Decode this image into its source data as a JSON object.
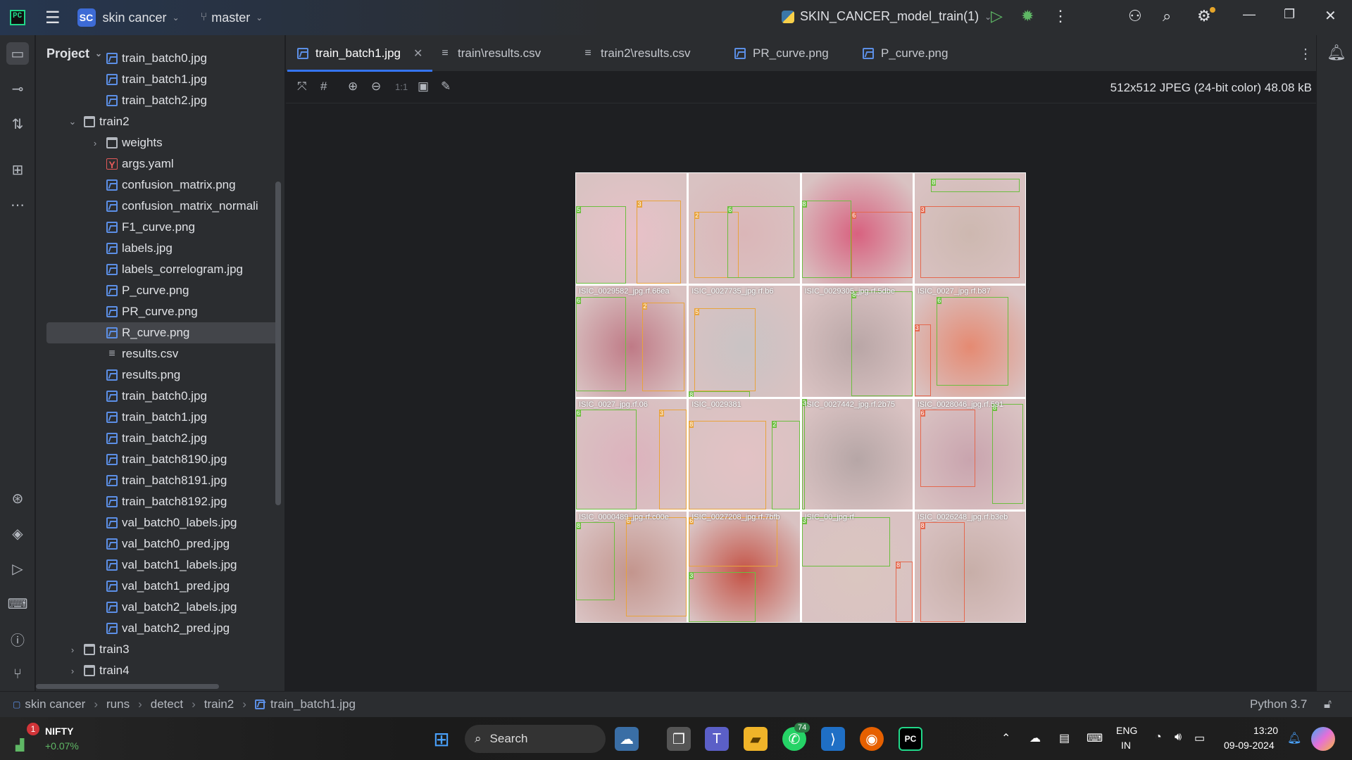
{
  "titlebar": {
    "project_badge": "SC",
    "project_name": "skin cancer",
    "branch": "master",
    "run_config": "SKIN_CANCER_model_train(1)"
  },
  "project_panel": {
    "title": "Project",
    "items": [
      {
        "label": "train_batch0.jpg",
        "kind": "image",
        "depth": 3
      },
      {
        "label": "train_batch1.jpg",
        "kind": "image",
        "depth": 3
      },
      {
        "label": "train_batch2.jpg",
        "kind": "image",
        "depth": 3
      },
      {
        "label": "train2",
        "kind": "folder-open",
        "depth": 2
      },
      {
        "label": "weights",
        "kind": "folder-closed",
        "depth": 3
      },
      {
        "label": "args.yaml",
        "kind": "yaml",
        "depth": 3
      },
      {
        "label": "confusion_matrix.png",
        "kind": "image",
        "depth": 3
      },
      {
        "label": "confusion_matrix_normali",
        "kind": "image",
        "depth": 3
      },
      {
        "label": "F1_curve.png",
        "kind": "image",
        "depth": 3
      },
      {
        "label": "labels.jpg",
        "kind": "image",
        "depth": 3
      },
      {
        "label": "labels_correlogram.jpg",
        "kind": "image",
        "depth": 3
      },
      {
        "label": "P_curve.png",
        "kind": "image",
        "depth": 3
      },
      {
        "label": "PR_curve.png",
        "kind": "image",
        "depth": 3
      },
      {
        "label": "R_curve.png",
        "kind": "image",
        "depth": 3,
        "selected": true
      },
      {
        "label": "results.csv",
        "kind": "text",
        "depth": 3
      },
      {
        "label": "results.png",
        "kind": "image",
        "depth": 3
      },
      {
        "label": "train_batch0.jpg",
        "kind": "image",
        "depth": 3
      },
      {
        "label": "train_batch1.jpg",
        "kind": "image",
        "depth": 3
      },
      {
        "label": "train_batch2.jpg",
        "kind": "image",
        "depth": 3
      },
      {
        "label": "train_batch8190.jpg",
        "kind": "image",
        "depth": 3
      },
      {
        "label": "train_batch8191.jpg",
        "kind": "image",
        "depth": 3
      },
      {
        "label": "train_batch8192.jpg",
        "kind": "image",
        "depth": 3
      },
      {
        "label": "val_batch0_labels.jpg",
        "kind": "image",
        "depth": 3
      },
      {
        "label": "val_batch0_pred.jpg",
        "kind": "image",
        "depth": 3
      },
      {
        "label": "val_batch1_labels.jpg",
        "kind": "image",
        "depth": 3
      },
      {
        "label": "val_batch1_pred.jpg",
        "kind": "image",
        "depth": 3
      },
      {
        "label": "val_batch2_labels.jpg",
        "kind": "image",
        "depth": 3
      },
      {
        "label": "val_batch2_pred.jpg",
        "kind": "image",
        "depth": 3
      },
      {
        "label": "train3",
        "kind": "folder-closed",
        "depth": 2
      },
      {
        "label": "train4",
        "kind": "folder-closed",
        "depth": 2
      }
    ]
  },
  "tabs": [
    {
      "label": "train_batch1.jpg",
      "icon": "image-icon",
      "active": true,
      "closable": true
    },
    {
      "label": "train\\results.csv",
      "icon": "text-file-icon"
    },
    {
      "label": "train2\\results.csv",
      "icon": "text-file-icon"
    },
    {
      "label": "PR_curve.png",
      "icon": "image-icon"
    },
    {
      "label": "P_curve.png",
      "icon": "image-icon"
    }
  ],
  "image_toolbar": {
    "actual_size": "1:1",
    "info": "512x512 JPEG (24-bit color) 48.08 kB"
  },
  "collage": {
    "cells": [
      {
        "bg": "#e8c1c8",
        "label": ""
      },
      {
        "bg": "#dab6b8",
        "label": ""
      },
      {
        "bg": "#d8617f",
        "label": ""
      },
      {
        "bg": "#cdb8b0",
        "label": ""
      },
      {
        "bg": "#bf7a86",
        "label": "ISIC_0029582_jpg.rf.66ea"
      },
      {
        "bg": "#c9c3c4",
        "label": "ISIC_0027735_jpg.rf.b6"
      },
      {
        "bg": "#b9a6a6",
        "label": "ISIC_0029305_jpg.rf.5dbe"
      },
      {
        "bg": "#e58a72",
        "label": "ISIC_0027_jpg.rf.b87"
      },
      {
        "bg": "#dcb2bd",
        "label": "ISIC_0027_jpg.rf.06"
      },
      {
        "bg": "#e3c2c5",
        "label": "ISIC_0029381"
      },
      {
        "bg": "#b6a6a6",
        "label": "ISIC_0027442_jpg.rf.2b75"
      },
      {
        "bg": "#c9a4ae",
        "label": "ISIC_0028046_jpg.rf.591"
      },
      {
        "bg": "#c3958d",
        "label": "ISIC_0000489_jpg.rf.c00e"
      },
      {
        "bg": "#c45346",
        "label": "ISIC_0027208_jpg.rf.7bfb"
      },
      {
        "bg": "#dac6c0",
        "label": "ISIC_00_jpg.rf"
      },
      {
        "bg": "#c7aea8",
        "label": "ISIC_0026248_jpg.rf.b3eb"
      }
    ]
  },
  "statusbar": {
    "breadcrumb": [
      "skin cancer",
      "runs",
      "detect",
      "train2",
      "train_batch1.jpg"
    ],
    "interpreter": "Python 3.7"
  },
  "taskbar": {
    "stock_name": "NIFTY",
    "stock_change": "+0.07%",
    "stock_alert": "1",
    "search_label": "Search",
    "whatsapp_badge": "74",
    "lang_top": "ENG",
    "lang_bottom": "IN",
    "time": "13:20",
    "date": "09-09-2024"
  },
  "colors": {
    "accent": "#3574f0",
    "box_green": "#6cbd3f",
    "box_orange": "#e8a33c",
    "box_red": "#e4684e"
  }
}
